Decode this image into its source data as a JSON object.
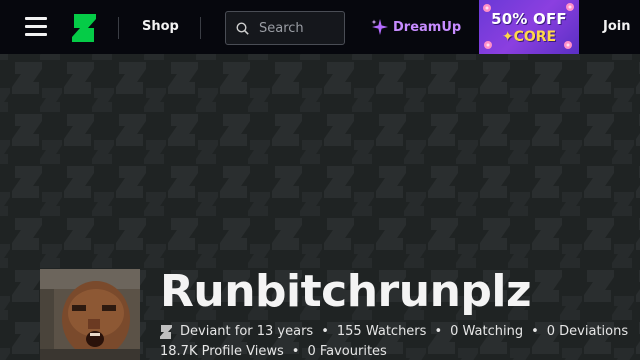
{
  "header": {
    "shop_label": "Shop",
    "search_placeholder": "Search",
    "dreamup_label": "DreamUp",
    "promo": {
      "line1": "50% OFF",
      "line2": "✦CORE"
    },
    "join_label": "Join"
  },
  "profile": {
    "username": "Runbitchrunplz",
    "deviant_for": "Deviant for 13 years",
    "watchers": "155 Watchers",
    "watching": "0 Watching",
    "deviations": "0 Deviations",
    "profile_views": "18.7K Profile Views",
    "favourites": "0 Favourites"
  },
  "colors": {
    "topbar_bg": "#06070d",
    "banner_bg": "#1f2323",
    "brand_green": "#05cc47",
    "dreamup_purple": "#c78cff",
    "promo_purple": "#7a3ddc",
    "promo_yellow": "#ffd84a"
  },
  "icons": {
    "menu": "hamburger-icon",
    "logo": "deviantart-logo-icon",
    "search": "search-icon",
    "dreamup": "sparkle-icon",
    "deviant": "deviantart-small-icon"
  }
}
